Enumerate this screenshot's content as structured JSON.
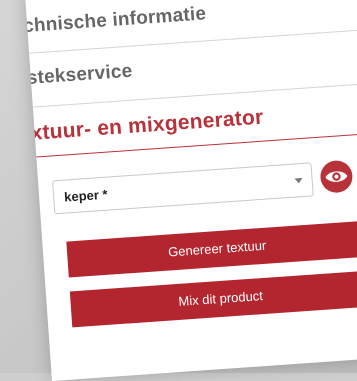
{
  "sections": [
    {
      "title": "chnische informatie"
    },
    {
      "title": "stekservice"
    },
    {
      "title": "xtuur- en mixgenerator"
    }
  ],
  "select": {
    "value": "keper *"
  },
  "buttons": {
    "generate": "Genereer textuur",
    "mix": "Mix dit product"
  },
  "colors": {
    "accent": "#b8323a",
    "button": "#b3262f"
  },
  "icons": {
    "preview": "eye-icon",
    "dropdown": "chevron-down-icon"
  }
}
